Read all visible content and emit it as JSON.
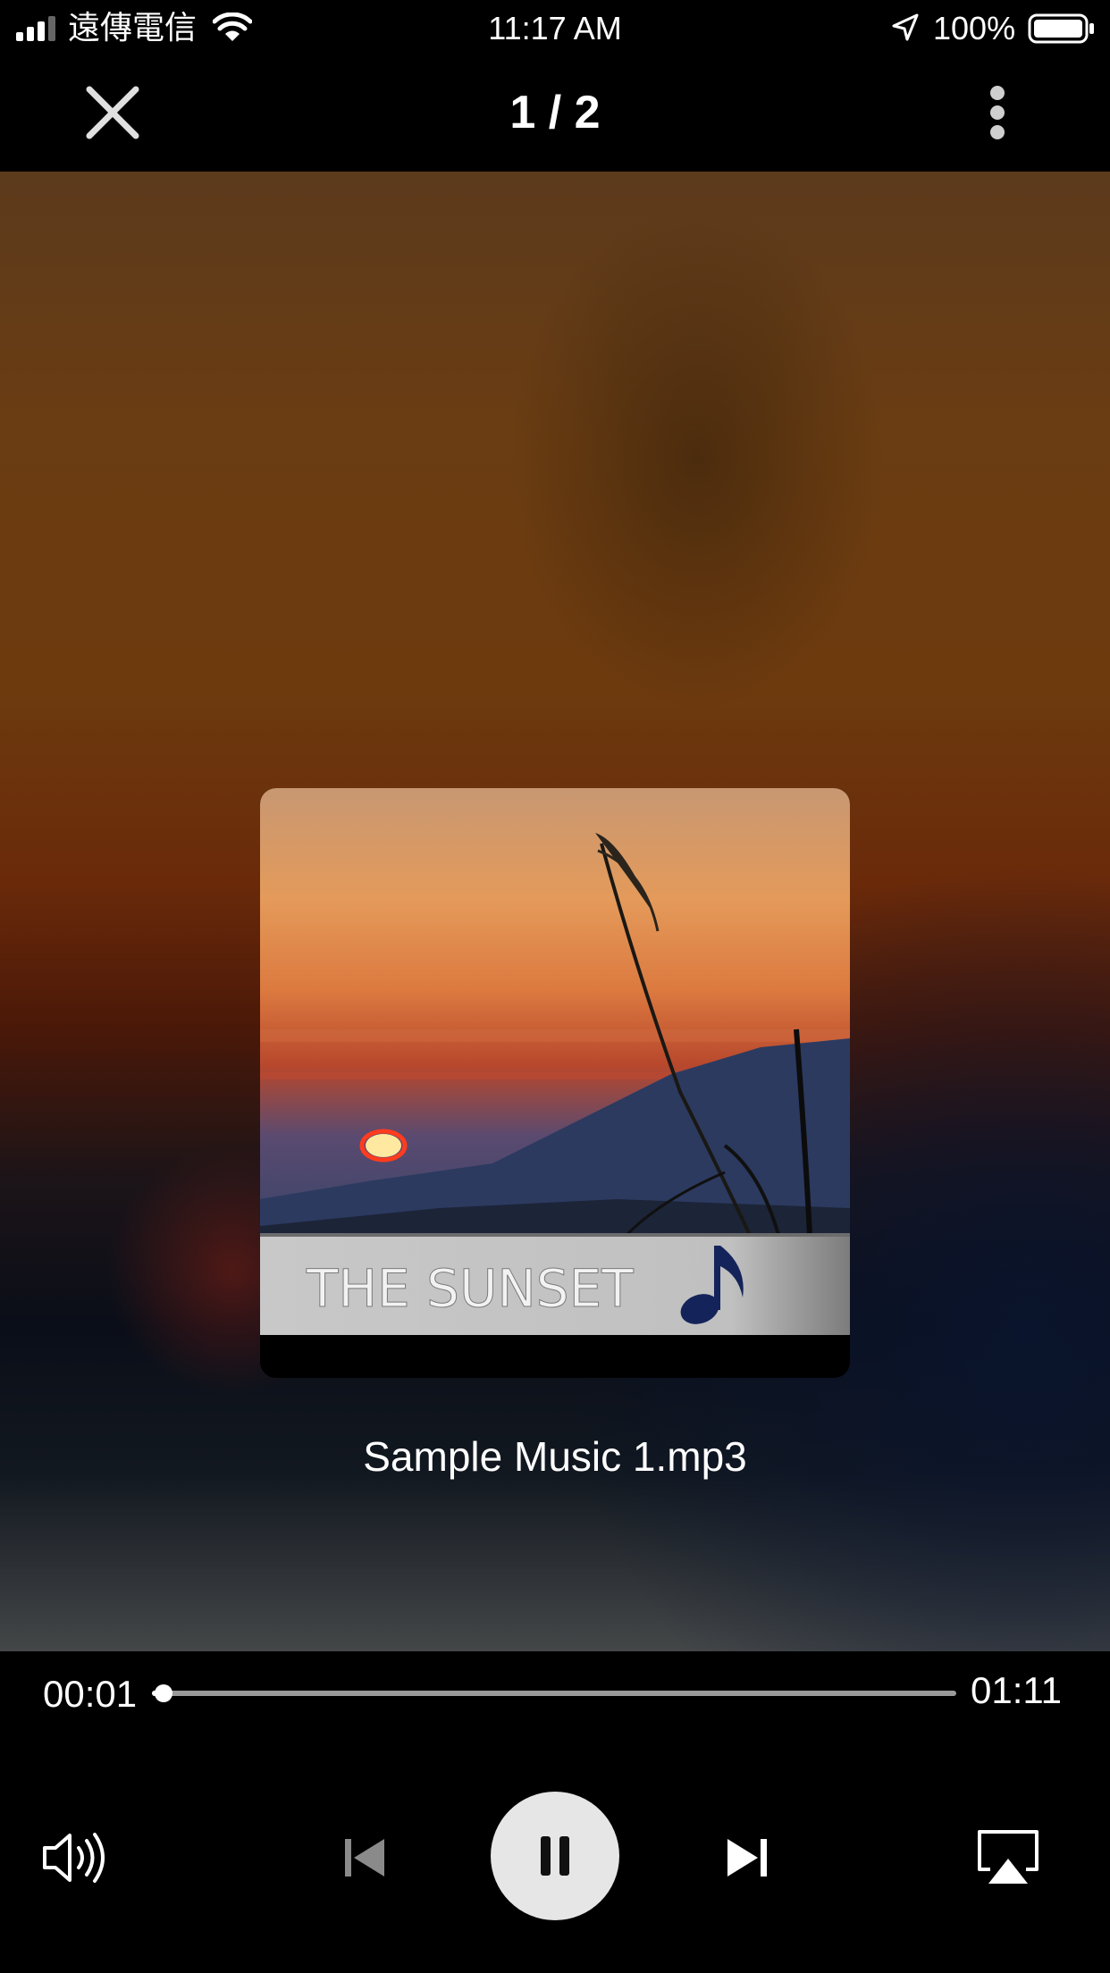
{
  "status_bar": {
    "carrier": "遠傳電信",
    "time": "11:17 AM",
    "battery": "100%"
  },
  "nav": {
    "counter": "1 / 2",
    "close_icon": "close-icon",
    "more_icon": "more-vertical-icon"
  },
  "album_art": {
    "caption": "THE SUNSET",
    "icon": "music-note-icon"
  },
  "track": {
    "file_name": "Sample Music 1.mp3"
  },
  "playback": {
    "elapsed": "00:01",
    "total": "01:11",
    "progress_fraction": 0.014,
    "state": "playing"
  },
  "controls": {
    "volume_icon": "speaker-icon",
    "prev_icon": "skip-previous-icon",
    "play_pause_icon": "pause-icon",
    "next_icon": "skip-next-icon",
    "airplay_icon": "airplay-icon"
  },
  "colors": {
    "background": "#000000",
    "play_button": "#e6e6e6"
  }
}
